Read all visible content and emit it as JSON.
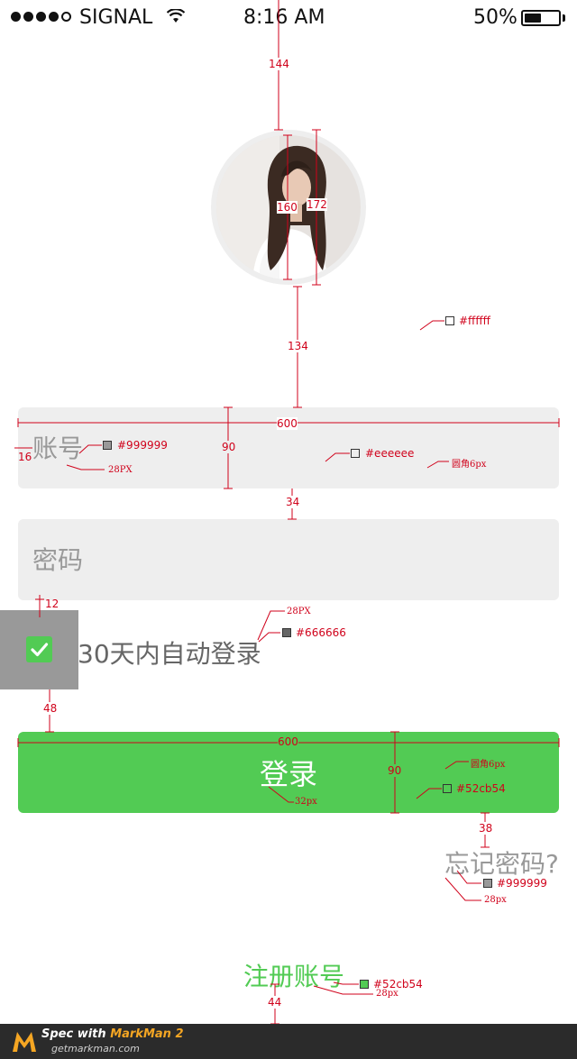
{
  "status_bar": {
    "carrier": "SIGNAL",
    "time": "8:16 AM",
    "battery_percent": "50%",
    "battery_level": 0.5,
    "signal_bars_filled": 4,
    "signal_bars_total": 5
  },
  "avatar": {
    "alt": "user avatar"
  },
  "form": {
    "account_placeholder": "账号",
    "password_placeholder": "密码",
    "remember_label": "30天内自动登录",
    "remember_checked": true,
    "login_label": "登录",
    "forgot_label": "忘记密码?",
    "register_label": "注册账号"
  },
  "colors": {
    "background": "#ffffff",
    "field_bg": "#eeeeee",
    "placeholder": "#999999",
    "remember_text": "#666666",
    "accent": "#52cb54"
  },
  "annotations": {
    "top_gap": "144",
    "avatar_inner": "160",
    "avatar_outer": "172",
    "avatar_bottom_gap": "134",
    "bg_color": "#ffffff",
    "field_width": "600",
    "field_height": "90",
    "field_padding": "16",
    "placeholder_color": "#999999",
    "placeholder_size": "28PX",
    "field_color": "#eeeeee",
    "field_radius": "圆角6px",
    "field_gap": "34",
    "remember_gap": "12",
    "remember_size": "28PX",
    "remember_color": "#666666",
    "button_gap": "48",
    "button_width": "600",
    "button_height": "90",
    "button_font": "32px",
    "button_radius": "圆角6px",
    "button_color": "#52cb54",
    "forgot_gap": "38",
    "forgot_color": "#999999",
    "forgot_size": "28px",
    "register_color": "#52cb54",
    "register_size": "28px",
    "bottom_gap": "44"
  },
  "footer": {
    "spec_with": "Spec with",
    "brand": "MarkMan 2",
    "site": "getmarkman.com"
  }
}
